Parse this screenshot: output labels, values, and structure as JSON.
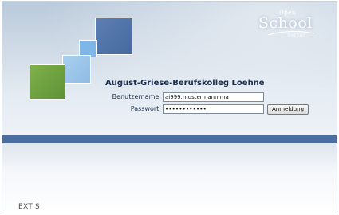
{
  "branding": {
    "logo_line1": "Open",
    "logo_line2": "School",
    "logo_line3": "Server",
    "footer_logo": "EXTIS"
  },
  "school_name": "August-Griese-Berufskolleg Loehne",
  "login": {
    "username_label": "Benutzername:",
    "username_value": "ai999.mustermann.ma",
    "password_label": "Passwort:",
    "password_masked": "••••••••••••",
    "submit_label": "Anmeldung"
  },
  "colors": {
    "header_top": "#b9cadb",
    "accent_bar": "#4a6e9f",
    "square_green": "#6aa03e",
    "square_dark_blue": "#5274a8",
    "square_light_blue": "#9cc6ea"
  }
}
